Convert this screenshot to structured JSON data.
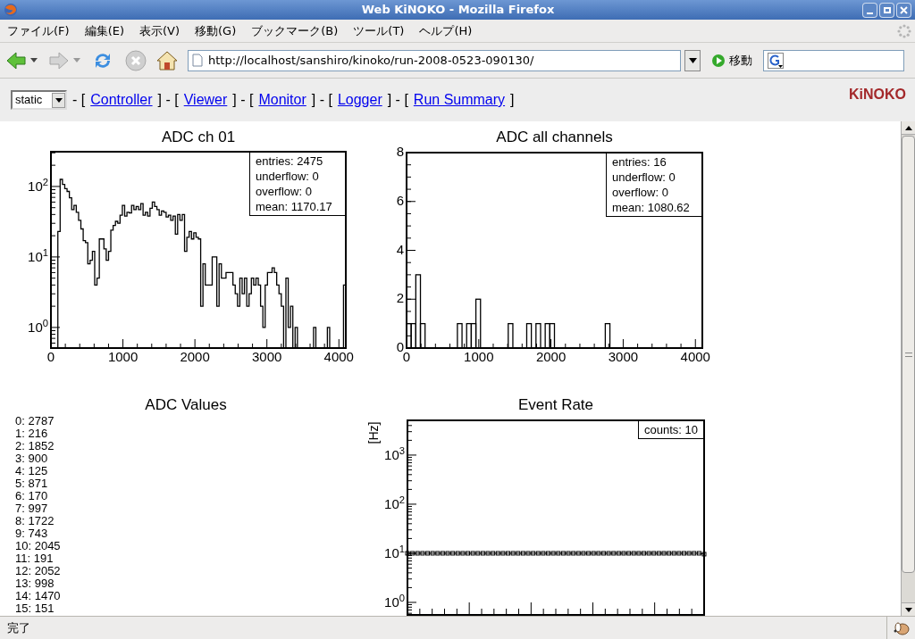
{
  "window": {
    "title": "Web KiNOKO - Mozilla Firefox"
  },
  "menu": [
    "ファイル(F)",
    "編集(E)",
    "表示(V)",
    "移動(G)",
    "ブックマーク(B)",
    "ツール(T)",
    "ヘルプ(H)"
  ],
  "toolbar": {
    "url": "http://localhost/sanshiro/kinoko/run-2008-0523-090130/",
    "go": "移動"
  },
  "nav": {
    "select": "static",
    "items": [
      {
        "kind": "text",
        "text": "- ["
      },
      {
        "kind": "link",
        "text": "Controller"
      },
      {
        "kind": "text",
        "text": "] - ["
      },
      {
        "kind": "link",
        "text": "Viewer"
      },
      {
        "kind": "text",
        "text": "] - ["
      },
      {
        "kind": "link",
        "text": "Monitor"
      },
      {
        "kind": "text",
        "text": "] - ["
      },
      {
        "kind": "link",
        "text": "Logger"
      },
      {
        "kind": "text",
        "text": "] - ["
      },
      {
        "kind": "link",
        "text": "Run Summary"
      },
      {
        "kind": "text",
        "text": "]"
      }
    ],
    "brand": "KiNOKO"
  },
  "panels": [
    {
      "kind": "plot",
      "title": "ADC ch 01",
      "x_tick_labels": [
        "0",
        "1000",
        "2000",
        "3000",
        "4000"
      ],
      "y_tick_labels": [
        "10$^{2}$",
        "10$^{1}$",
        "10$^{0}$"
      ],
      "stats": [
        "entries: 2475",
        "underflow: 0",
        "overflow: 0",
        "mean: 1170.17"
      ]
    },
    {
      "kind": "chart",
      "stats": [
        "entries: 16",
        "underflow: 0",
        "overflow: 0",
        "mean: 1080.62"
      ],
      "chart_data": {
        "type": "bar",
        "title": "ADC all channels",
        "xlim": [
          0,
          4096
        ],
        "ylim": [
          0,
          8
        ],
        "xticks": [
          0,
          1000,
          2000,
          3000,
          4000
        ],
        "yticks": [
          0,
          2,
          4,
          6,
          8
        ],
        "x": [
          32,
          96,
          160,
          224,
          736,
          864,
          928,
          992,
          1440,
          1696,
          1824,
          1952,
          2016,
          2784
        ],
        "values": [
          1,
          1,
          3,
          1,
          1,
          1,
          1,
          2,
          1,
          1,
          1,
          1,
          1,
          1
        ]
      }
    },
    {
      "kind": "list",
      "title": "ADC Values",
      "lines": [
        "0: 2787",
        "1: 216",
        "2: 1852",
        "3: 900",
        "4: 125",
        "5: 871",
        "6: 170",
        "7: 997",
        "8: 1722",
        "9: 743",
        "10: 2045",
        "11: 191",
        "12: 2052",
        "13: 998",
        "14: 1470",
        "15: 151"
      ]
    },
    {
      "kind": "plot",
      "title": "Event Rate",
      "ylabel": "[Hz]",
      "y_tick_labels": [
        "10$^{3}$",
        "10$^{2}$",
        "10$^{1}$",
        "10$^{0}$"
      ],
      "stats": [
        "counts: 10"
      ]
    }
  ],
  "status_bar": {
    "text": "完了"
  }
}
